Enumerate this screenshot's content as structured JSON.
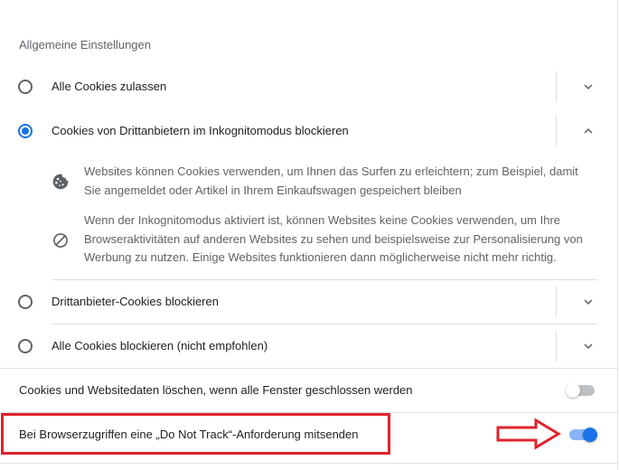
{
  "section": {
    "title": "Allgemeine Einstellungen"
  },
  "options": [
    {
      "label": "Alle Cookies zulassen",
      "selected": false,
      "expanded": false
    },
    {
      "label": "Cookies von Drittanbietern im Inkognitomodus blockieren",
      "selected": true,
      "expanded": true
    },
    {
      "label": "Drittanbieter-Cookies blockieren",
      "selected": false,
      "expanded": false
    },
    {
      "label": "Alle Cookies blockieren (nicht empfohlen)",
      "selected": false,
      "expanded": false
    }
  ],
  "details": [
    {
      "icon": "cookie-icon",
      "text": "Websites können Cookies verwenden, um Ihnen das Surfen zu erleichtern; zum Beispiel, damit Sie angemeldet oder Artikel in Ihrem Einkaufswagen gespeichert bleiben"
    },
    {
      "icon": "block-icon",
      "text": "Wenn der Inkognitomodus aktiviert ist, können Websites keine Cookies verwenden, um Ihre Browseraktivitäten auf anderen Websites zu sehen und beispielsweise zur Personalisierung von Werbung zu nutzen. Einige Websites funktionieren dann möglicherweise nicht mehr richtig."
    }
  ],
  "toggles": [
    {
      "label": "Cookies und Websitedaten löschen, wenn alle Fenster geschlossen werden",
      "on": false
    },
    {
      "label": "Bei Browserzugriffen eine „Do Not Track“-Anforderung mitsenden",
      "on": true
    }
  ],
  "colors": {
    "accent": "#1a73e8",
    "annotation": "#e0232b"
  }
}
